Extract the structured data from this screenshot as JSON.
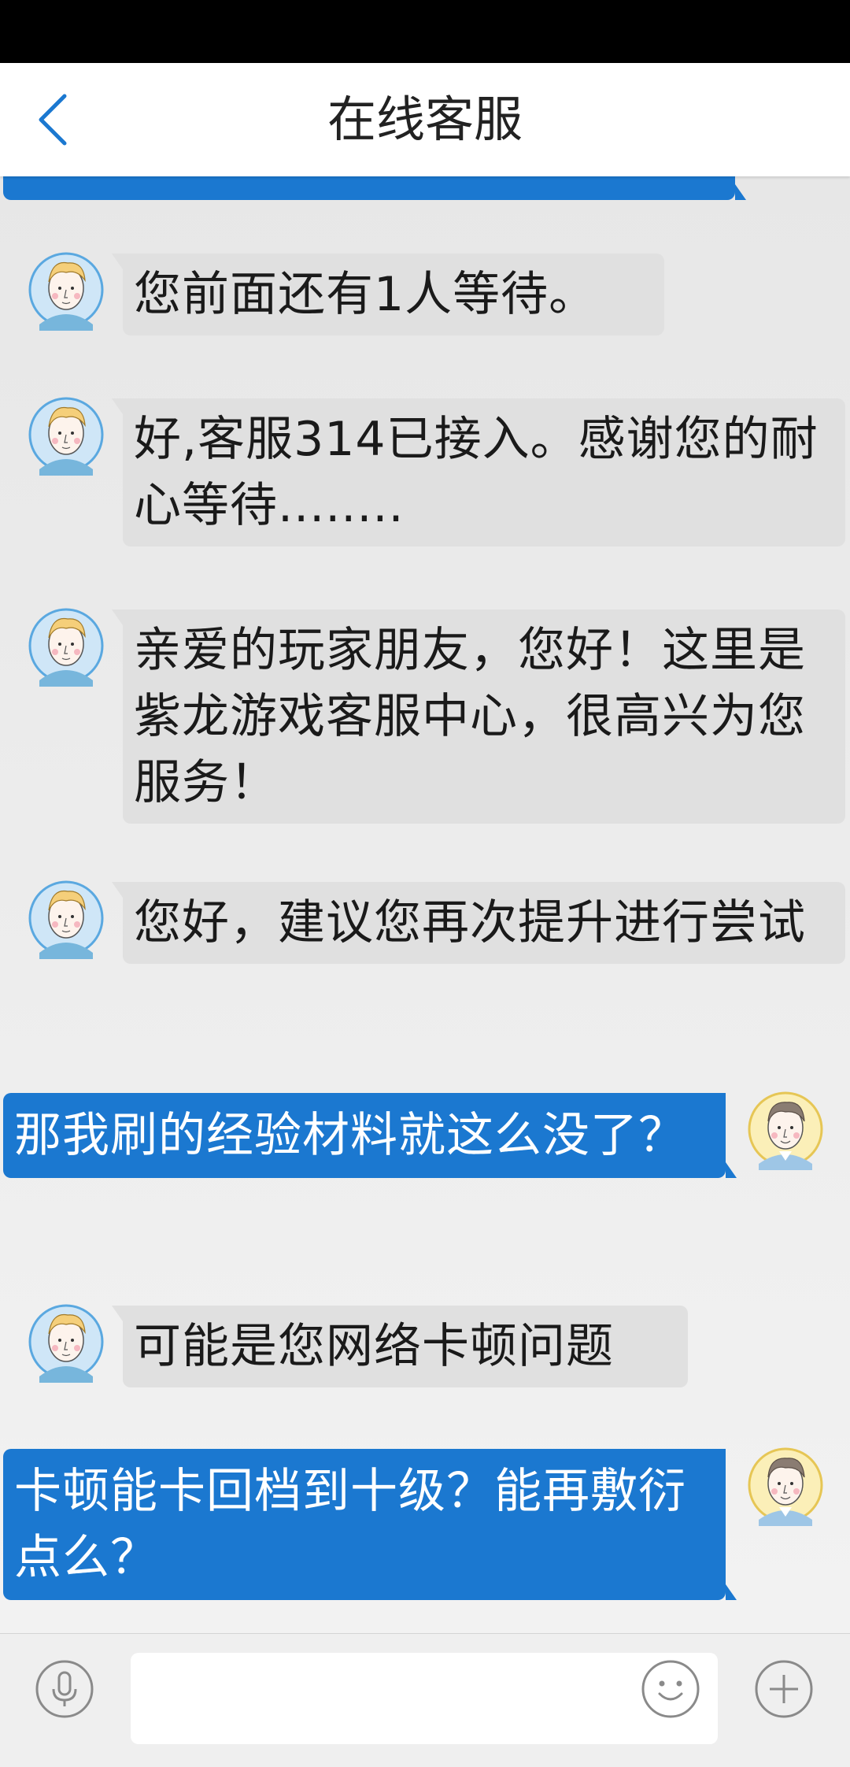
{
  "header": {
    "title": "在线客服",
    "back_icon": "chevron-left-icon"
  },
  "colors": {
    "user_bubble": "#1b78d0",
    "agent_bubble": "#e0e0e0",
    "accent": "#1b78d0"
  },
  "messages": [
    {
      "sender": "user",
      "text": ""
    },
    {
      "sender": "agent",
      "text": "您前面还有1人等待。"
    },
    {
      "sender": "agent",
      "text": "好,客服314已接入。感谢您的耐心等待........"
    },
    {
      "sender": "agent",
      "text": "亲爱的玩家朋友，您好！这里是紫龙游戏客服中心，很高兴为您服务！"
    },
    {
      "sender": "agent",
      "text": "您好，建议您再次提升进行尝试"
    },
    {
      "sender": "user",
      "text": "那我刷的经验材料就这么没了？"
    },
    {
      "sender": "agent",
      "text": "可能是您网络卡顿问题"
    },
    {
      "sender": "user",
      "text": "卡顿能卡回档到十级？能再敷衍点么？"
    }
  ],
  "input_bar": {
    "mic_icon": "microphone-icon",
    "input_value": "",
    "emoji_icon": "emoji-icon",
    "plus_icon": "plus-icon"
  }
}
